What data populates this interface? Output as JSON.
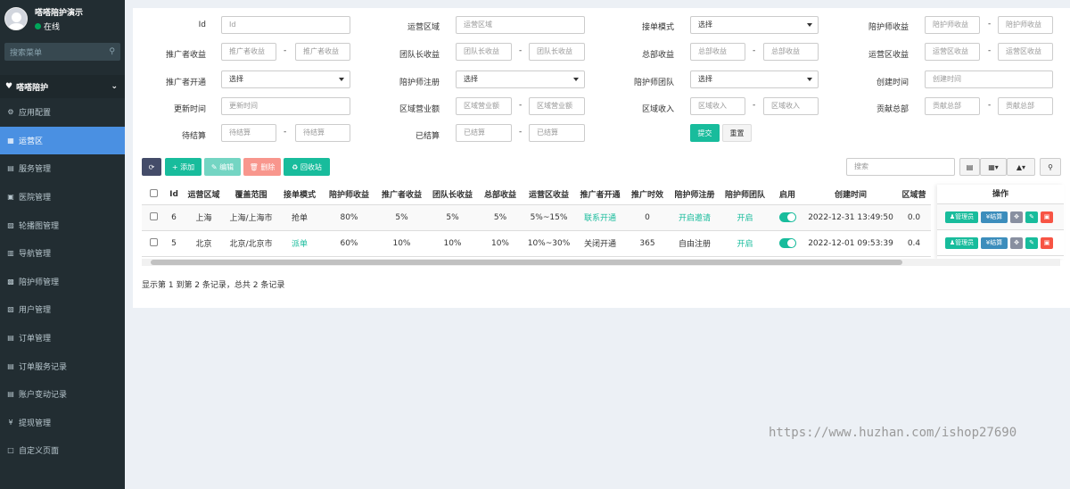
{
  "sidebar": {
    "user_name": "嗒嗒陪护演示",
    "user_status": "在线",
    "search_placeholder": "搜索菜单",
    "section_title": "嗒嗒陪护",
    "items": [
      {
        "label": "应用配置",
        "icon": "gear-icon"
      },
      {
        "label": "运营区",
        "icon": "map-icon"
      },
      {
        "label": "服务管理",
        "icon": "list-icon"
      },
      {
        "label": "医院管理",
        "icon": "hospital-icon"
      },
      {
        "label": "轮播图管理",
        "icon": "image-icon"
      },
      {
        "label": "导航管理",
        "icon": "nav-icon"
      },
      {
        "label": "陪护师管理",
        "icon": "user-icon"
      },
      {
        "label": "用户管理",
        "icon": "users-icon"
      },
      {
        "label": "订单管理",
        "icon": "order-icon"
      },
      {
        "label": "订单服务记录",
        "icon": "record-icon"
      },
      {
        "label": "账户变动记录",
        "icon": "account-icon"
      },
      {
        "label": "提现管理",
        "icon": "yen-icon"
      },
      {
        "label": "自定义页面",
        "icon": "page-icon"
      }
    ],
    "active_index": 1
  },
  "filters": {
    "labels": {
      "id": "Id",
      "region": "运营区域",
      "order_mode": "接单模式",
      "caregiver_income": "陪护师收益",
      "promoter_income": "推广者收益",
      "leader_income": "团队长收益",
      "hq_income": "总部收益",
      "region_income": "运营区收益",
      "promoter_open": "推广者开通",
      "caregiver_reg": "陪护师注册",
      "caregiver_team": "陪护师团队",
      "create_time": "创建时间",
      "update_time": "更新时间",
      "region_turnover": "区域营业额",
      "region_revenue": "区域收入",
      "hq_contrib": "贡献总部",
      "pending": "待结算",
      "settled": "已结算"
    },
    "placeholders": {
      "id": "Id",
      "region": "运营区域",
      "select": "选择",
      "caregiver_income": "陪护师收益",
      "promoter_income": "推广者收益",
      "leader_income": "团队长收益",
      "hq_income": "总部收益",
      "region_income": "运营区收益",
      "create_time": "创建时间",
      "update_time": "更新时间",
      "region_turnover": "区域营业额",
      "region_revenue": "区域收入",
      "hq_contrib": "贡献总部",
      "pending": "待结算",
      "settled": "已结算"
    },
    "dash": "-",
    "submit": "提交",
    "reset": "重置"
  },
  "toolbar": {
    "add": "添加",
    "edit": "编辑",
    "delete": "删除",
    "recycle": "回收站",
    "search_placeholder": "搜索"
  },
  "table": {
    "headers": [
      "Id",
      "运营区域",
      "覆盖范围",
      "接单模式",
      "陪护师收益",
      "推广者收益",
      "团队长收益",
      "总部收益",
      "运营区收益",
      "推广者开通",
      "推广时效",
      "陪护师注册",
      "陪护师团队",
      "启用",
      "创建时间",
      "区域营"
    ],
    "ops_header": "操作",
    "rows": [
      {
        "id": "6",
        "region": "上海",
        "coverage": "上海/上海市",
        "mode": "抢单",
        "caregiver": "80%",
        "promoter": "5%",
        "leader": "5%",
        "hq": "5%",
        "region_income": "5%~15%",
        "promoter_open": "联系开通",
        "promo_time": "0",
        "caregiver_reg": "开启邀请",
        "team": "开启",
        "created": "2022-12-31 13:49:50",
        "turnover": "0.0"
      },
      {
        "id": "5",
        "region": "北京",
        "coverage": "北京/北京市",
        "mode": "派单",
        "caregiver": "60%",
        "promoter": "10%",
        "leader": "10%",
        "hq": "10%",
        "region_income": "10%~30%",
        "promoter_open": "关闭开通",
        "promo_time": "365",
        "caregiver_reg": "自由注册",
        "team": "开启",
        "created": "2022-12-01 09:53:39",
        "turnover": "0.4"
      }
    ],
    "ops_buttons": {
      "admin": "管理员",
      "settle": "结算"
    }
  },
  "summary": "显示第 1 到第 2 条记录，总共 2 条记录",
  "watermark": "https://www.huzhan.com/ishop27690",
  "colors": {
    "sidebar": "#222d32",
    "active": "#4a90e2",
    "primary": "#18bc9c",
    "dark": "#444c69",
    "danger": "#f75444"
  }
}
